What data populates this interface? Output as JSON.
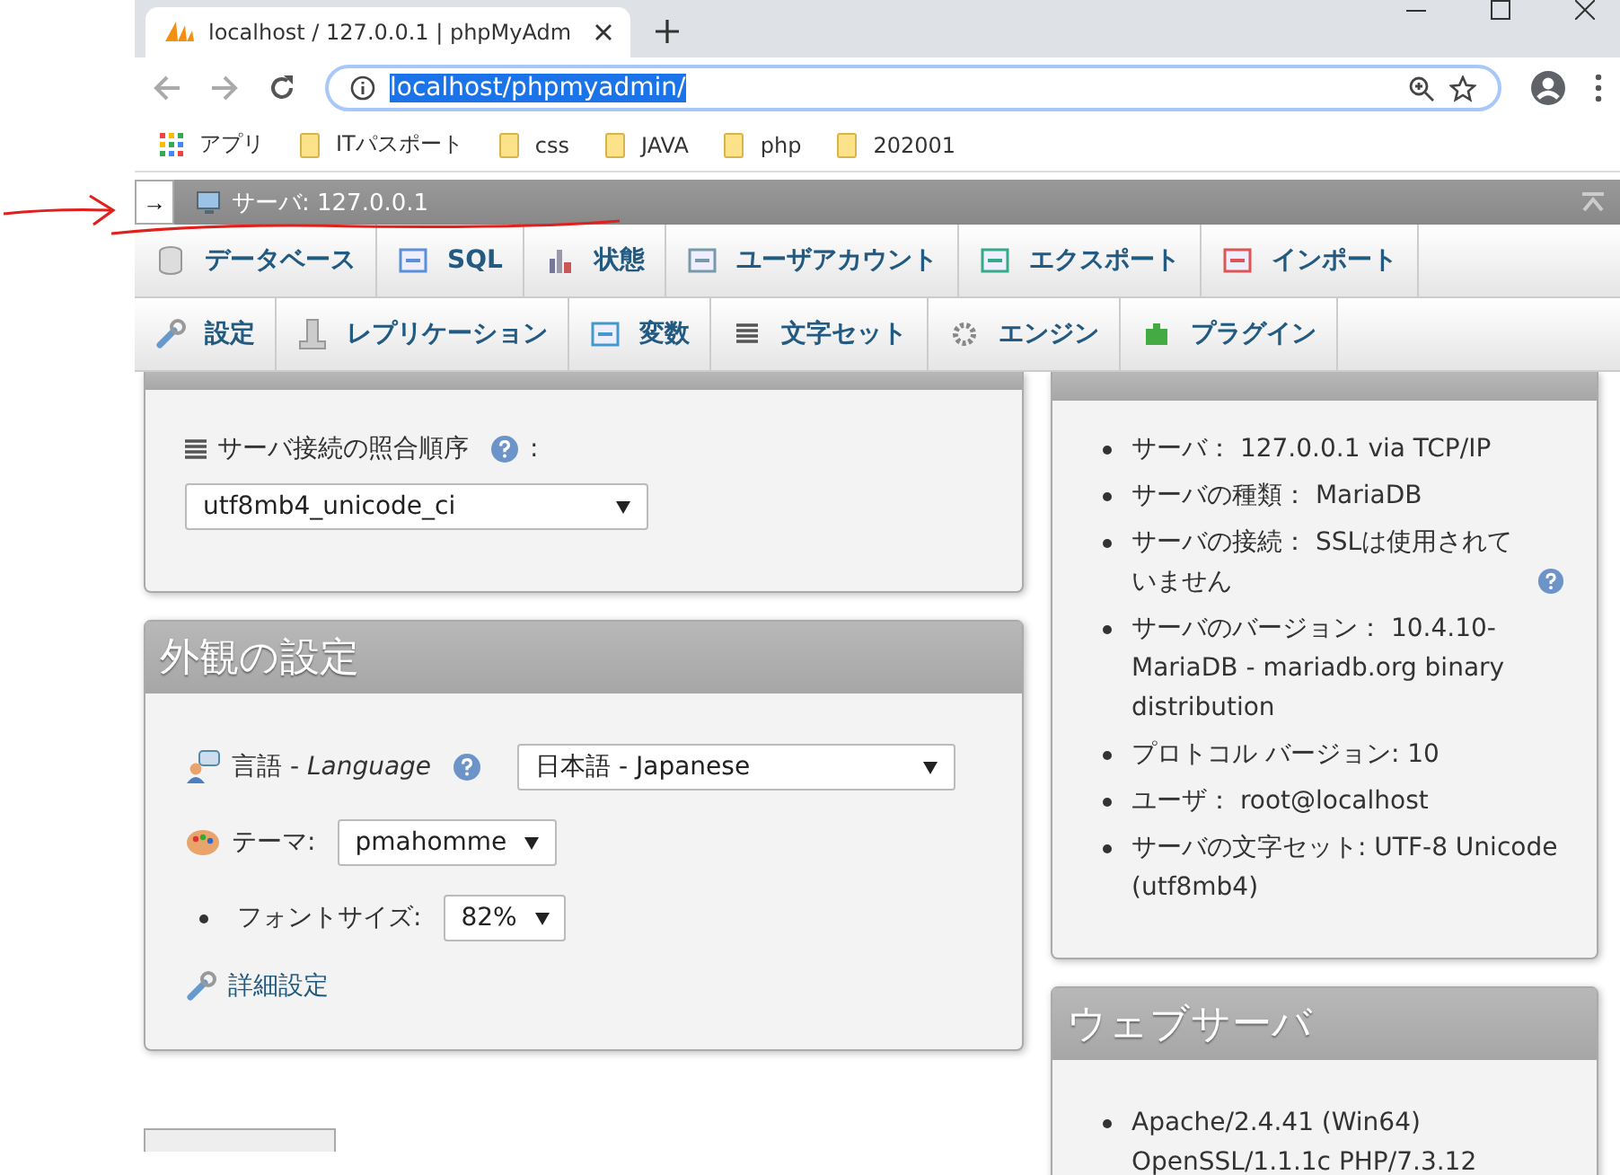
{
  "browser": {
    "tab_title": "localhost / 127.0.0.1 | phpMyAdm",
    "url": "localhost/phpmyadmin/",
    "bookmarks": [
      {
        "kind": "apps",
        "label": "アプリ"
      },
      {
        "kind": "folder",
        "label": "ITパスポート"
      },
      {
        "kind": "folder",
        "label": "css"
      },
      {
        "kind": "folder",
        "label": "JAVA"
      },
      {
        "kind": "folder",
        "label": "php"
      },
      {
        "kind": "folder",
        "label": "202001"
      }
    ]
  },
  "breadcrumb": {
    "toggle": "→",
    "server": "サーバ: 127.0.0.1"
  },
  "menu_rows": [
    [
      {
        "kind": "database",
        "label": "データベース"
      },
      {
        "kind": "sql",
        "label": "SQL"
      },
      {
        "kind": "status",
        "label": "状態"
      },
      {
        "kind": "users",
        "label": "ユーザアカウント"
      },
      {
        "kind": "export",
        "label": "エクスポート"
      },
      {
        "kind": "import",
        "label": "インポート"
      }
    ],
    [
      {
        "kind": "settings",
        "label": "設定"
      },
      {
        "kind": "replication",
        "label": "レプリケーション"
      },
      {
        "kind": "variables",
        "label": "変数"
      },
      {
        "kind": "charset",
        "label": "文字セット"
      },
      {
        "kind": "engines",
        "label": "エンジン"
      },
      {
        "kind": "plugins",
        "label": "プラグイン"
      }
    ]
  ],
  "general_panel": {
    "collation_label": "サーバ接続の照合順序",
    "collation_colon": ":",
    "collation_value": "utf8mb4_unicode_ci"
  },
  "appearance_panel": {
    "title": "外観の設定",
    "language_label": "言語 - *Language*",
    "language_value": "日本語 - Japanese",
    "theme_label": "テーマ:",
    "theme_value": "pmahomme",
    "font_size_label": "フォントサイズ:",
    "font_size_value": "82%",
    "more_settings": "詳細設定"
  },
  "db_server_panel": {
    "items": [
      {
        "text": "サーバ： 127.0.0.1 via TCP/IP",
        "help": false
      },
      {
        "text": "サーバの種類： MariaDB",
        "help": false
      },
      {
        "text": "サーバの接続： SSLは使用されていません",
        "help": true
      },
      {
        "text": "サーバのバージョン： 10.4.10-MariaDB - mariadb.org binary distribution",
        "help": false
      },
      {
        "text": "プロトコル バージョン: 10",
        "help": false
      },
      {
        "text": "ユーザ： root@localhost",
        "help": false
      },
      {
        "text": "サーバの文字セット: UTF-8 Unicode (utf8mb4)",
        "help": false
      }
    ]
  },
  "web_server_panel": {
    "title": "ウェブサーバ",
    "items": [
      "Apache/2.4.41 (Win64) OpenSSL/1.1.1c PHP/7.3.12"
    ]
  }
}
